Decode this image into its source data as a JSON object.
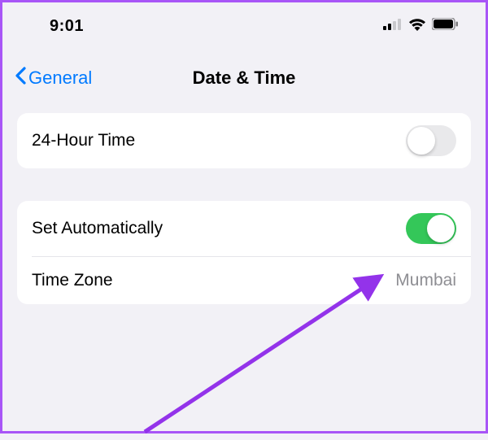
{
  "status_bar": {
    "time": "9:01"
  },
  "nav": {
    "back_label": "General",
    "title": "Date & Time"
  },
  "group1": {
    "row1_label": "24-Hour Time",
    "row1_toggle_on": false
  },
  "group2": {
    "row1_label": "Set Automatically",
    "row1_toggle_on": true,
    "row2_label": "Time Zone",
    "row2_value": "Mumbai"
  },
  "colors": {
    "accent_blue": "#007aff",
    "toggle_green": "#34c759",
    "border_purple": "#a855f7",
    "arrow_purple": "#9333ea"
  }
}
